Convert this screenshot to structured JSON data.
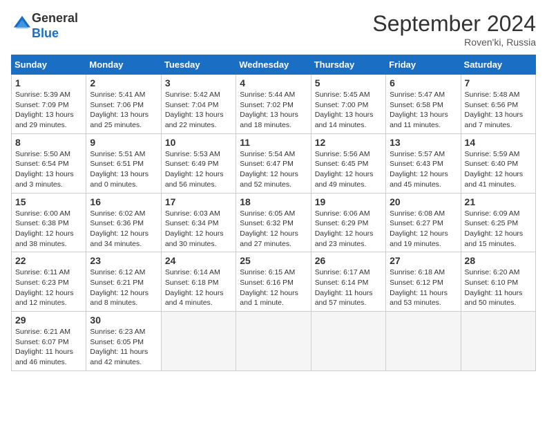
{
  "header": {
    "logo_general": "General",
    "logo_blue": "Blue",
    "month_title": "September 2024",
    "location": "Roven'ki, Russia"
  },
  "weekdays": [
    "Sunday",
    "Monday",
    "Tuesday",
    "Wednesday",
    "Thursday",
    "Friday",
    "Saturday"
  ],
  "weeks": [
    [
      {
        "day": "1",
        "info": "Sunrise: 5:39 AM\nSunset: 7:09 PM\nDaylight: 13 hours\nand 29 minutes."
      },
      {
        "day": "2",
        "info": "Sunrise: 5:41 AM\nSunset: 7:06 PM\nDaylight: 13 hours\nand 25 minutes."
      },
      {
        "day": "3",
        "info": "Sunrise: 5:42 AM\nSunset: 7:04 PM\nDaylight: 13 hours\nand 22 minutes."
      },
      {
        "day": "4",
        "info": "Sunrise: 5:44 AM\nSunset: 7:02 PM\nDaylight: 13 hours\nand 18 minutes."
      },
      {
        "day": "5",
        "info": "Sunrise: 5:45 AM\nSunset: 7:00 PM\nDaylight: 13 hours\nand 14 minutes."
      },
      {
        "day": "6",
        "info": "Sunrise: 5:47 AM\nSunset: 6:58 PM\nDaylight: 13 hours\nand 11 minutes."
      },
      {
        "day": "7",
        "info": "Sunrise: 5:48 AM\nSunset: 6:56 PM\nDaylight: 13 hours\nand 7 minutes."
      }
    ],
    [
      {
        "day": "8",
        "info": "Sunrise: 5:50 AM\nSunset: 6:54 PM\nDaylight: 13 hours\nand 3 minutes."
      },
      {
        "day": "9",
        "info": "Sunrise: 5:51 AM\nSunset: 6:51 PM\nDaylight: 13 hours\nand 0 minutes."
      },
      {
        "day": "10",
        "info": "Sunrise: 5:53 AM\nSunset: 6:49 PM\nDaylight: 12 hours\nand 56 minutes."
      },
      {
        "day": "11",
        "info": "Sunrise: 5:54 AM\nSunset: 6:47 PM\nDaylight: 12 hours\nand 52 minutes."
      },
      {
        "day": "12",
        "info": "Sunrise: 5:56 AM\nSunset: 6:45 PM\nDaylight: 12 hours\nand 49 minutes."
      },
      {
        "day": "13",
        "info": "Sunrise: 5:57 AM\nSunset: 6:43 PM\nDaylight: 12 hours\nand 45 minutes."
      },
      {
        "day": "14",
        "info": "Sunrise: 5:59 AM\nSunset: 6:40 PM\nDaylight: 12 hours\nand 41 minutes."
      }
    ],
    [
      {
        "day": "15",
        "info": "Sunrise: 6:00 AM\nSunset: 6:38 PM\nDaylight: 12 hours\nand 38 minutes."
      },
      {
        "day": "16",
        "info": "Sunrise: 6:02 AM\nSunset: 6:36 PM\nDaylight: 12 hours\nand 34 minutes."
      },
      {
        "day": "17",
        "info": "Sunrise: 6:03 AM\nSunset: 6:34 PM\nDaylight: 12 hours\nand 30 minutes."
      },
      {
        "day": "18",
        "info": "Sunrise: 6:05 AM\nSunset: 6:32 PM\nDaylight: 12 hours\nand 27 minutes."
      },
      {
        "day": "19",
        "info": "Sunrise: 6:06 AM\nSunset: 6:29 PM\nDaylight: 12 hours\nand 23 minutes."
      },
      {
        "day": "20",
        "info": "Sunrise: 6:08 AM\nSunset: 6:27 PM\nDaylight: 12 hours\nand 19 minutes."
      },
      {
        "day": "21",
        "info": "Sunrise: 6:09 AM\nSunset: 6:25 PM\nDaylight: 12 hours\nand 15 minutes."
      }
    ],
    [
      {
        "day": "22",
        "info": "Sunrise: 6:11 AM\nSunset: 6:23 PM\nDaylight: 12 hours\nand 12 minutes."
      },
      {
        "day": "23",
        "info": "Sunrise: 6:12 AM\nSunset: 6:21 PM\nDaylight: 12 hours\nand 8 minutes."
      },
      {
        "day": "24",
        "info": "Sunrise: 6:14 AM\nSunset: 6:18 PM\nDaylight: 12 hours\nand 4 minutes."
      },
      {
        "day": "25",
        "info": "Sunrise: 6:15 AM\nSunset: 6:16 PM\nDaylight: 12 hours\nand 1 minute."
      },
      {
        "day": "26",
        "info": "Sunrise: 6:17 AM\nSunset: 6:14 PM\nDaylight: 11 hours\nand 57 minutes."
      },
      {
        "day": "27",
        "info": "Sunrise: 6:18 AM\nSunset: 6:12 PM\nDaylight: 11 hours\nand 53 minutes."
      },
      {
        "day": "28",
        "info": "Sunrise: 6:20 AM\nSunset: 6:10 PM\nDaylight: 11 hours\nand 50 minutes."
      }
    ],
    [
      {
        "day": "29",
        "info": "Sunrise: 6:21 AM\nSunset: 6:07 PM\nDaylight: 11 hours\nand 46 minutes."
      },
      {
        "day": "30",
        "info": "Sunrise: 6:23 AM\nSunset: 6:05 PM\nDaylight: 11 hours\nand 42 minutes."
      },
      {
        "day": "",
        "info": ""
      },
      {
        "day": "",
        "info": ""
      },
      {
        "day": "",
        "info": ""
      },
      {
        "day": "",
        "info": ""
      },
      {
        "day": "",
        "info": ""
      }
    ]
  ]
}
